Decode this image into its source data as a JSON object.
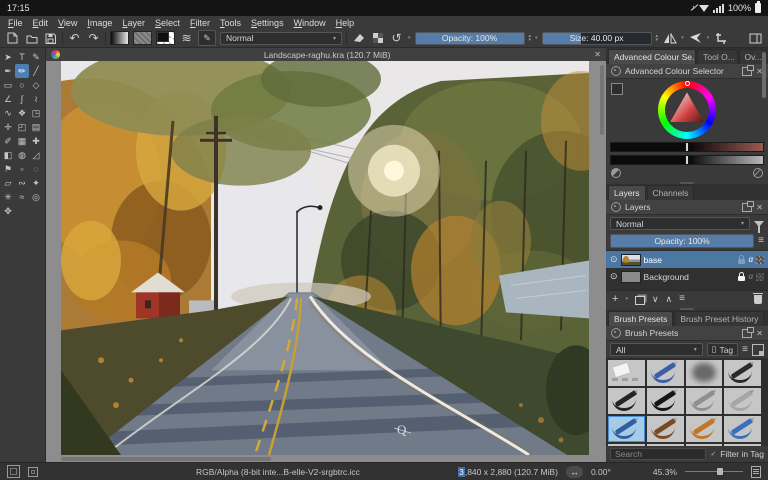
{
  "android_bar": {
    "time": "17:15",
    "battery_pct": "100%"
  },
  "menu": {
    "items": [
      "File",
      "Edit",
      "View",
      "Image",
      "Layer",
      "Select",
      "Filter",
      "Tools",
      "Settings",
      "Window",
      "Help"
    ]
  },
  "toolbar": {
    "blend_mode": "Normal",
    "opacity": "Opacity: 100%",
    "size": "Size: 40.00 px"
  },
  "icons": {
    "close": "✕",
    "undo": "↶",
    "redo": "↷",
    "reload": "↺",
    "caret": "▾",
    "burger": "≡",
    "plus": "+",
    "arrow_up": "∧",
    "arrow_down": "∨",
    "alpha": "α",
    "check": "✓",
    "arrow_lr": "↔",
    "eye": "⊙",
    "brush_settings": "≋",
    "spin_up": "▴",
    "spin_down": "▾",
    "tag_box": "▯"
  },
  "canvas": {
    "title": "Landscape-raghu.kra (120.7 MiB)",
    "signature": "Q"
  },
  "color_selector": {
    "tab_advanced": "Advanced Colour Se...",
    "tab_tool": "Tool O...",
    "tab_overview": "Ov...",
    "title": "Advanced Colour Selector"
  },
  "layers": {
    "tab_layers": "Layers",
    "tab_channels": "Channels",
    "title": "Layers",
    "blend_mode": "Normal",
    "opacity": "Opacity: 100%",
    "rows": [
      {
        "name": "base"
      },
      {
        "name": "Background"
      }
    ]
  },
  "brush_presets": {
    "tab_presets": "Brush Presets",
    "tab_history": "Brush Preset History",
    "title": "Brush Presets",
    "tag_filter": "All",
    "tag_button": "Tag",
    "search_placeholder": "Search",
    "filter_in_tag": "Filter in Tag",
    "cells": [
      {
        "name": "eraser-soft",
        "type": "eraser",
        "color": "#f2f2f2"
      },
      {
        "name": "ink-pen-blue",
        "type": "pen",
        "color": "#3a5fa8"
      },
      {
        "name": "airbrush-soft",
        "type": "airbrush",
        "color": "#5a5a5a"
      },
      {
        "name": "ink-pen-black",
        "type": "pen",
        "color": "#2a2a2a"
      },
      {
        "name": "charcoal",
        "type": "pen",
        "color": "#242424"
      },
      {
        "name": "brush-black",
        "type": "pen",
        "color": "#161616"
      },
      {
        "name": "marker-chisel",
        "type": "pen",
        "color": "#8f8f8f"
      },
      {
        "name": "marker-soft",
        "type": "pen",
        "color": "#a5a5a5"
      },
      {
        "name": "pen-blue",
        "type": "pen",
        "color": "#2f5fa0",
        "selected": true
      },
      {
        "name": "brush-brown",
        "type": "pen",
        "color": "#7a4a22"
      },
      {
        "name": "pencil-orange",
        "type": "pen",
        "color": "#c07828"
      },
      {
        "name": "pencil-blue",
        "type": "pen",
        "color": "#3a70b8"
      },
      {
        "name": "pencil-blue-2",
        "type": "pen",
        "color": "#4a6ab0"
      },
      {
        "name": "pen-blue-2",
        "type": "pen",
        "color": "#2a4a9a"
      },
      {
        "name": "brush-dark-brown",
        "type": "pen",
        "color": "#3a2a22"
      },
      {
        "name": "pencil-tan",
        "type": "pen",
        "color": "#c0a070"
      }
    ]
  },
  "status_bar": {
    "profile": "RGB/Alpha (8-bit inte...B-elle-V2-srgbtrc.icc",
    "dims_highlight": "3",
    "dims_rest": ",840 x 2,880 (120.7 MiB)",
    "angle": "0.00°",
    "zoom": "45.3%"
  },
  "toolbox": {
    "tools": [
      {
        "name": "select-shapes",
        "glyph": "➤"
      },
      {
        "name": "text",
        "glyph": "T"
      },
      {
        "name": "edit-shapes",
        "glyph": "✎"
      },
      {
        "name": "calligraphy",
        "glyph": "✒"
      },
      {
        "name": "freehand-brush",
        "glyph": "✏",
        "selected": true
      },
      {
        "name": "line",
        "glyph": "╱"
      },
      {
        "name": "rectangle",
        "glyph": "▭"
      },
      {
        "name": "ellipse",
        "glyph": "○"
      },
      {
        "name": "polygon",
        "glyph": "◇"
      },
      {
        "name": "polyline",
        "glyph": "∠"
      },
      {
        "name": "bezier-curve",
        "glyph": "∫"
      },
      {
        "name": "freehand-path",
        "glyph": "≀"
      },
      {
        "name": "dynamic-brush",
        "glyph": "∿"
      },
      {
        "name": "multibrush",
        "glyph": "❖"
      },
      {
        "name": "transform",
        "glyph": "◳"
      },
      {
        "name": "move",
        "glyph": "✛"
      },
      {
        "name": "crop",
        "glyph": "◰"
      },
      {
        "name": "gradient",
        "glyph": "▤"
      },
      {
        "name": "color-sampler",
        "glyph": "✐"
      },
      {
        "name": "pattern-edit",
        "glyph": "▦"
      },
      {
        "name": "smart-patch",
        "glyph": "✚"
      },
      {
        "name": "fill",
        "glyph": "◧"
      },
      {
        "name": "enclose-fill",
        "glyph": "◍"
      },
      {
        "name": "measure",
        "glyph": "◿"
      },
      {
        "name": "reference-images",
        "glyph": "⚑"
      },
      {
        "name": "rect-select",
        "glyph": "▫"
      },
      {
        "name": "ellipse-select",
        "glyph": "◌"
      },
      {
        "name": "polygonal-select",
        "glyph": "▱"
      },
      {
        "name": "outline-select",
        "glyph": "∾"
      },
      {
        "name": "similar-select",
        "glyph": "✦"
      },
      {
        "name": "contiguous-select",
        "glyph": "✳"
      },
      {
        "name": "bezier-select",
        "glyph": "≈"
      },
      {
        "name": "zoom",
        "glyph": "◎"
      },
      {
        "name": "pan",
        "glyph": "✥"
      }
    ]
  },
  "colors": {
    "accent_blue": "#567da8",
    "selection_blue": "#4c77a3",
    "preset_selected": "#a6cbe6"
  }
}
